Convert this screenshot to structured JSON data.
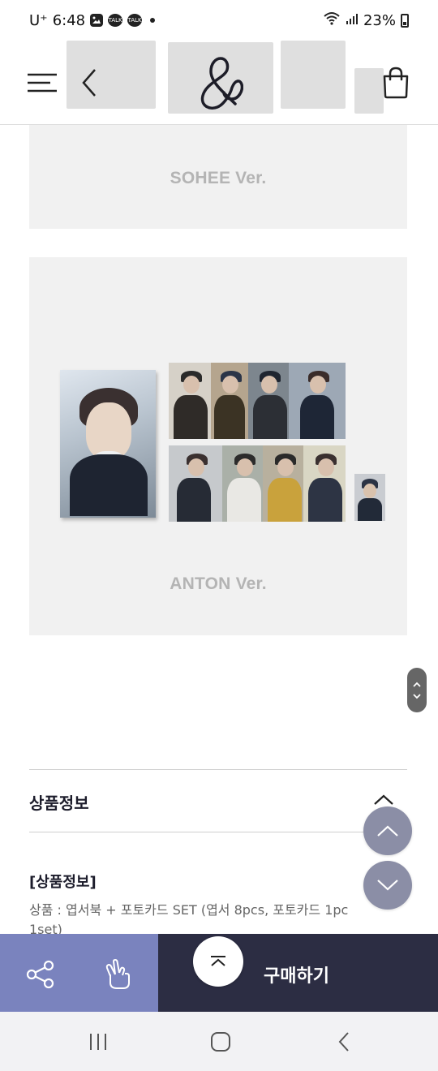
{
  "status_bar": {
    "carrier": "U⁺",
    "time": "6:48",
    "notif_icons": [
      "gallery-icon",
      "talk-icon",
      "talk-icon"
    ],
    "talk_label": "TALK",
    "battery": "23%"
  },
  "header": {
    "menu_icon": "hamburger-icon",
    "back_icon": "chevron-left-icon",
    "logo_icon": "ampersand-logo-icon",
    "cart_icon": "shopping-bag-icon"
  },
  "product_images": [
    {
      "label": "SOHEE Ver."
    },
    {
      "label": "ANTON Ver."
    }
  ],
  "product_info": {
    "section_title": "상품정보",
    "heading": "[상품정보]",
    "line": "상품 : 엽서북 + 포토카드 SET (엽서 8pcs, 포토카드 1pc",
    "line_cont": "1set)"
  },
  "bottom_bar": {
    "share_icon": "share-icon",
    "like_icon": "finger-heart-icon",
    "scroll_top_icon": "chevron-up-icon",
    "buy_label": "구매하기"
  },
  "colors": {
    "accent_purple": "#7a83be",
    "dark_navy": "#2c2d43",
    "fab_gray": "#8b8ea6",
    "panel_bg": "#f1f1f1"
  }
}
